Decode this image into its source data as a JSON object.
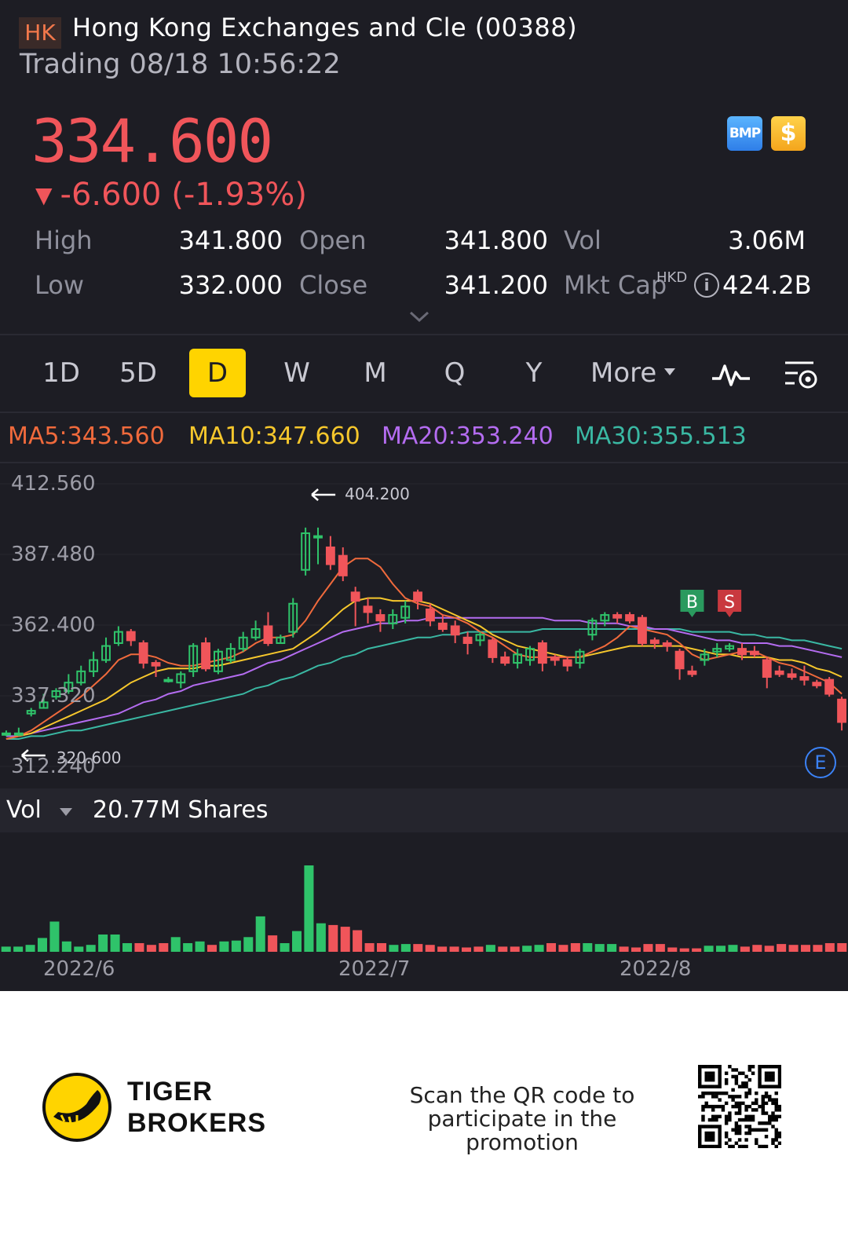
{
  "header": {
    "market_badge": "HK",
    "title": "Hong Kong Exchanges and Cle (00388)",
    "status": "Trading 08/18 10:56:22"
  },
  "quote": {
    "price": "334.600",
    "change": "-6.600 (-1.93%)",
    "change_arrow": "▼",
    "bmp_label": "BMP",
    "dollar_label": "$",
    "stats": {
      "high_label": "High",
      "high": "341.800",
      "low_label": "Low",
      "low": "332.000",
      "open_label": "Open",
      "open": "341.800",
      "close_label": "Close",
      "close": "341.200",
      "vol_label": "Vol",
      "vol": "3.06M",
      "mktcap_label": "Mkt Cap",
      "mktcap_currency": "HKD",
      "mktcap": "424.2B"
    }
  },
  "tabs": {
    "items": [
      "1D",
      "5D",
      "D",
      "W",
      "M",
      "Q",
      "Y"
    ],
    "more_label": "More",
    "active": "D"
  },
  "ma": {
    "ma5": "MA5:343.560",
    "ma10": "MA10:347.660",
    "ma20": "MA20:353.240",
    "ma30": "MA30:355.513"
  },
  "colors": {
    "up": "#2fc36a",
    "down": "#f0555a",
    "ma5": "#f06a3c",
    "ma10": "#f6c72c",
    "ma20": "#b46cf0",
    "ma30": "#3ab8a3",
    "accent": "#ffd400"
  },
  "chart_data": {
    "type": "candlestick",
    "y_ticks": [
      "412.560",
      "387.480",
      "362.400",
      "337.320",
      "312.240"
    ],
    "ylim": [
      312.24,
      412.56
    ],
    "high_marker": "404.200",
    "low_marker": "320.600",
    "signals": {
      "buy": "B",
      "sell": "S"
    },
    "event_marker": "E",
    "x_labels": [
      "2022/6",
      "2022/7",
      "2022/8"
    ],
    "x_label_index": [
      3,
      24,
      44
    ],
    "candles": [
      [
        324,
        324,
        325,
        323
      ],
      [
        324,
        324,
        326,
        323
      ],
      [
        331,
        332,
        333,
        330
      ],
      [
        333,
        335,
        338,
        333
      ],
      [
        337,
        339,
        340,
        336
      ],
      [
        339,
        342,
        345,
        338
      ],
      [
        342,
        346,
        348,
        341
      ],
      [
        346,
        350,
        353,
        344
      ],
      [
        350,
        355,
        358,
        349
      ],
      [
        356,
        360,
        362,
        355
      ],
      [
        360,
        357,
        361,
        355
      ],
      [
        356,
        349,
        357,
        347
      ],
      [
        349,
        348,
        350,
        344
      ],
      [
        343,
        343,
        344,
        342
      ],
      [
        342,
        345,
        346,
        340
      ],
      [
        346,
        355,
        356,
        344
      ],
      [
        356,
        347,
        358,
        346
      ],
      [
        346,
        353,
        354,
        345
      ],
      [
        350,
        354,
        356,
        349
      ],
      [
        354,
        358,
        360,
        353
      ],
      [
        358,
        361,
        364,
        357
      ],
      [
        362,
        356,
        367,
        355
      ],
      [
        356,
        358,
        359,
        356
      ],
      [
        360,
        370,
        372,
        358
      ],
      [
        382,
        395,
        397,
        380
      ],
      [
        394,
        394,
        397,
        384
      ],
      [
        390,
        384,
        394,
        382
      ],
      [
        387,
        380,
        390,
        378
      ],
      [
        374,
        371,
        376,
        362
      ],
      [
        369,
        367,
        372,
        363
      ],
      [
        366,
        364,
        368,
        360
      ],
      [
        363,
        366,
        368,
        361
      ],
      [
        365,
        369,
        371,
        363
      ],
      [
        374,
        371,
        375,
        368
      ],
      [
        368,
        364,
        370,
        362
      ],
      [
        363,
        361,
        366,
        360
      ],
      [
        362,
        359,
        364,
        356
      ],
      [
        358,
        356,
        360,
        352
      ],
      [
        357,
        359,
        360,
        355
      ],
      [
        357,
        351,
        358,
        349
      ],
      [
        351,
        349,
        353,
        348
      ],
      [
        349,
        352,
        354,
        347
      ],
      [
        350,
        354,
        355,
        348
      ],
      [
        356,
        349,
        357,
        346
      ],
      [
        351,
        350,
        352,
        348
      ],
      [
        350,
        348,
        351,
        346
      ],
      [
        349,
        353,
        354,
        347
      ],
      [
        359,
        364,
        365,
        357
      ],
      [
        364,
        366,
        367,
        362
      ],
      [
        366,
        365,
        367,
        363
      ],
      [
        366,
        364,
        367,
        363
      ],
      [
        365,
        356,
        366,
        355
      ],
      [
        357,
        356,
        358,
        354
      ],
      [
        356,
        355,
        357,
        353
      ],
      [
        353,
        347,
        354,
        343
      ],
      [
        346,
        345,
        348,
        344
      ],
      [
        350,
        352,
        354,
        348
      ],
      [
        353,
        354,
        356,
        351
      ],
      [
        354,
        355,
        356,
        353
      ],
      [
        354,
        352,
        356,
        350
      ],
      [
        353,
        352,
        355,
        351
      ],
      [
        350,
        344,
        351,
        340
      ],
      [
        346,
        345,
        348,
        344
      ],
      [
        345,
        344,
        347,
        343
      ],
      [
        344,
        343,
        348,
        341
      ],
      [
        342,
        341,
        343,
        340
      ],
      [
        343,
        338,
        344,
        337
      ],
      [
        336,
        328,
        337,
        325
      ]
    ],
    "ma_lines": {
      "MA5": [
        322,
        323,
        325,
        328,
        331,
        334,
        337,
        341,
        345,
        350,
        352,
        352,
        351,
        349,
        348,
        348,
        349,
        350,
        351,
        353,
        356,
        358,
        358,
        359,
        364,
        371,
        377,
        383,
        386,
        386,
        383,
        377,
        372,
        370,
        369,
        366,
        365,
        363,
        360,
        358,
        355,
        352,
        351,
        351,
        351,
        351,
        351,
        353,
        355,
        358,
        362,
        361,
        360,
        359,
        356,
        352,
        350,
        351,
        352,
        353,
        353,
        351,
        349,
        348,
        346,
        344,
        342,
        338
      ],
      "MA10": [
        322,
        323,
        324,
        326,
        328,
        330,
        332,
        334,
        336,
        339,
        342,
        344,
        346,
        347,
        347,
        347,
        348,
        348,
        349,
        350,
        351,
        352,
        353,
        354,
        357,
        360,
        364,
        368,
        371,
        372,
        372,
        371,
        371,
        371,
        370,
        368,
        366,
        364,
        362,
        359,
        357,
        355,
        354,
        353,
        352,
        351,
        351,
        352,
        353,
        354,
        355,
        355,
        355,
        355,
        355,
        354,
        353,
        352,
        352,
        351,
        351,
        351,
        350,
        350,
        349,
        347,
        346,
        344
      ],
      "MA20": [
        323,
        323,
        324,
        325,
        326,
        327,
        328,
        329,
        330,
        331,
        333,
        335,
        336,
        338,
        339,
        341,
        342,
        343,
        344,
        345,
        347,
        349,
        350,
        352,
        354,
        356,
        358,
        360,
        361,
        362,
        363,
        363,
        364,
        364,
        365,
        365,
        365,
        365,
        365,
        365,
        365,
        365,
        365,
        365,
        364,
        364,
        364,
        363,
        363,
        363,
        362,
        362,
        361,
        361,
        360,
        359,
        358,
        357,
        357,
        356,
        356,
        356,
        355,
        355,
        354,
        353,
        352,
        351
      ],
      "MA30": [
        322,
        322,
        323,
        323,
        324,
        325,
        325,
        326,
        327,
        328,
        329,
        330,
        331,
        332,
        333,
        334,
        335,
        336,
        337,
        338,
        340,
        341,
        343,
        344,
        346,
        348,
        349,
        351,
        352,
        354,
        355,
        356,
        357,
        358,
        358,
        359,
        359,
        360,
        360,
        360,
        360,
        360,
        360,
        361,
        361,
        361,
        361,
        361,
        361,
        361,
        361,
        361,
        361,
        361,
        361,
        360,
        360,
        360,
        360,
        359,
        359,
        358,
        358,
        357,
        357,
        356,
        355,
        354
      ]
    }
  },
  "volume": {
    "label": "Vol",
    "value": "20.77M Shares",
    "bars": [
      6,
      6,
      8,
      16,
      35,
      12,
      6,
      8,
      20,
      20,
      10,
      10,
      8,
      10,
      17,
      10,
      12,
      8,
      12,
      13,
      17,
      41,
      19,
      10,
      24,
      100,
      33,
      31,
      29,
      25,
      10,
      10,
      8,
      9,
      9,
      8,
      6,
      6,
      5,
      6,
      8,
      6,
      6,
      7,
      8,
      10,
      8,
      10,
      10,
      9,
      9,
      6,
      5,
      9,
      9,
      5,
      4,
      4,
      7,
      7,
      8,
      6,
      8,
      7,
      9,
      8,
      8,
      8,
      10,
      10
    ]
  },
  "footer": {
    "brand_line1": "TIGER",
    "brand_line2": "BROKERS",
    "promo_line1": "Scan the QR code to",
    "promo_line2": "participate in the promotion"
  }
}
